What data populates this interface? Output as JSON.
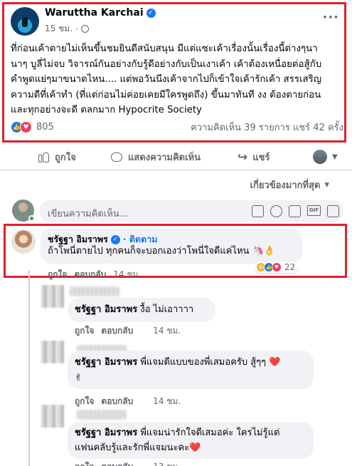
{
  "post": {
    "author": "Waruttha Karchai",
    "time": "15 ชม.",
    "more_icon": "more-dots-icon",
    "text_lines": [
      "ที่ก่อนเค้าตายไม่เห็นขึ้นชมยินดีสนับสนุน มีแต่แซะเค้าเรื่องนั้นเรื่องนี้ต่างๆนา",
      "นาๆ บูลี่ไม่จบ วิจารณ์กันอย่างกับรู้ดีอย่างกับเป็นเงาเค้า เค้าต้องเหนื่อยต่อสู้กับ",
      "คำพูดแย่ๆมาขนาดไหน.... แต่พอวันนึงเค้าจากไปก็เข้าใจเค้ารักเค้า สรรเสริญ",
      "ความดีที่เค้าทำ (ที่แต่ก่อนไม่ค่อยเคยมีใครพูดถึง) ขึ้นมาทันที งง ต้องตายก่อน",
      "และทุกอย่างจะดี ตลกมาก Hypocrite Society"
    ],
    "reaction_count": "805",
    "stats": "ความคิดเห็น 39 รายการ  แชร์ 42 ครั้ง"
  },
  "actions": {
    "like": "ถูกใจ",
    "comment": "แสดงความคิดเห็น",
    "share": "แชร์"
  },
  "sort": {
    "label": "เกี่ยวข้องมากที่สุด",
    "caret": "▾"
  },
  "composer": {
    "placeholder": "เขียนความคิดเห็น..."
  },
  "comments": [
    {
      "author": "ชรัฐฐา อิมราพร",
      "follow": "· ติดตาม",
      "text": "ถ้าโพนี่ตายไป ทุกคนก็จะบอกเองว่าโพนี่ใจดีแค่ไหน 🦄👌",
      "like": "ถูกใจ",
      "reply": "ตอบกลับ",
      "time": "14 ชม.",
      "reaction_count": "22"
    }
  ],
  "replies": [
    {
      "author": "ชรัฐฐา อิมราพร",
      "text": "งื้อ ไม่เอาาาา",
      "like": "ถูกใจ",
      "reply": "ตอบกลับ",
      "time": "14 ชม."
    },
    {
      "author": "ชรัฐฐา อิมราพร",
      "text": "พี่แจมดีแบบของพี่เสมอครับ สู้ๆๆ ❤️",
      "text2": "✌",
      "like": "ถูกใจ",
      "reply": "ตอบกลับ",
      "time": "14 ชม."
    },
    {
      "author": "ชรัฐฐา อิมราพร",
      "text": "พี่แจมน่ารักใจดีเสมอค่ะ ใครไม่รู้แต่",
      "text2": "แฟนคลับรู้และรักพี่แจมนะคะ❤️",
      "like": "ถูกใจ",
      "reply": "ตอบกลับ",
      "time": "13 ชม."
    }
  ],
  "colors": {
    "highlight_border": "#e0202a",
    "facebook_blue": "#1877f2",
    "secondary_text": "#65676b"
  }
}
